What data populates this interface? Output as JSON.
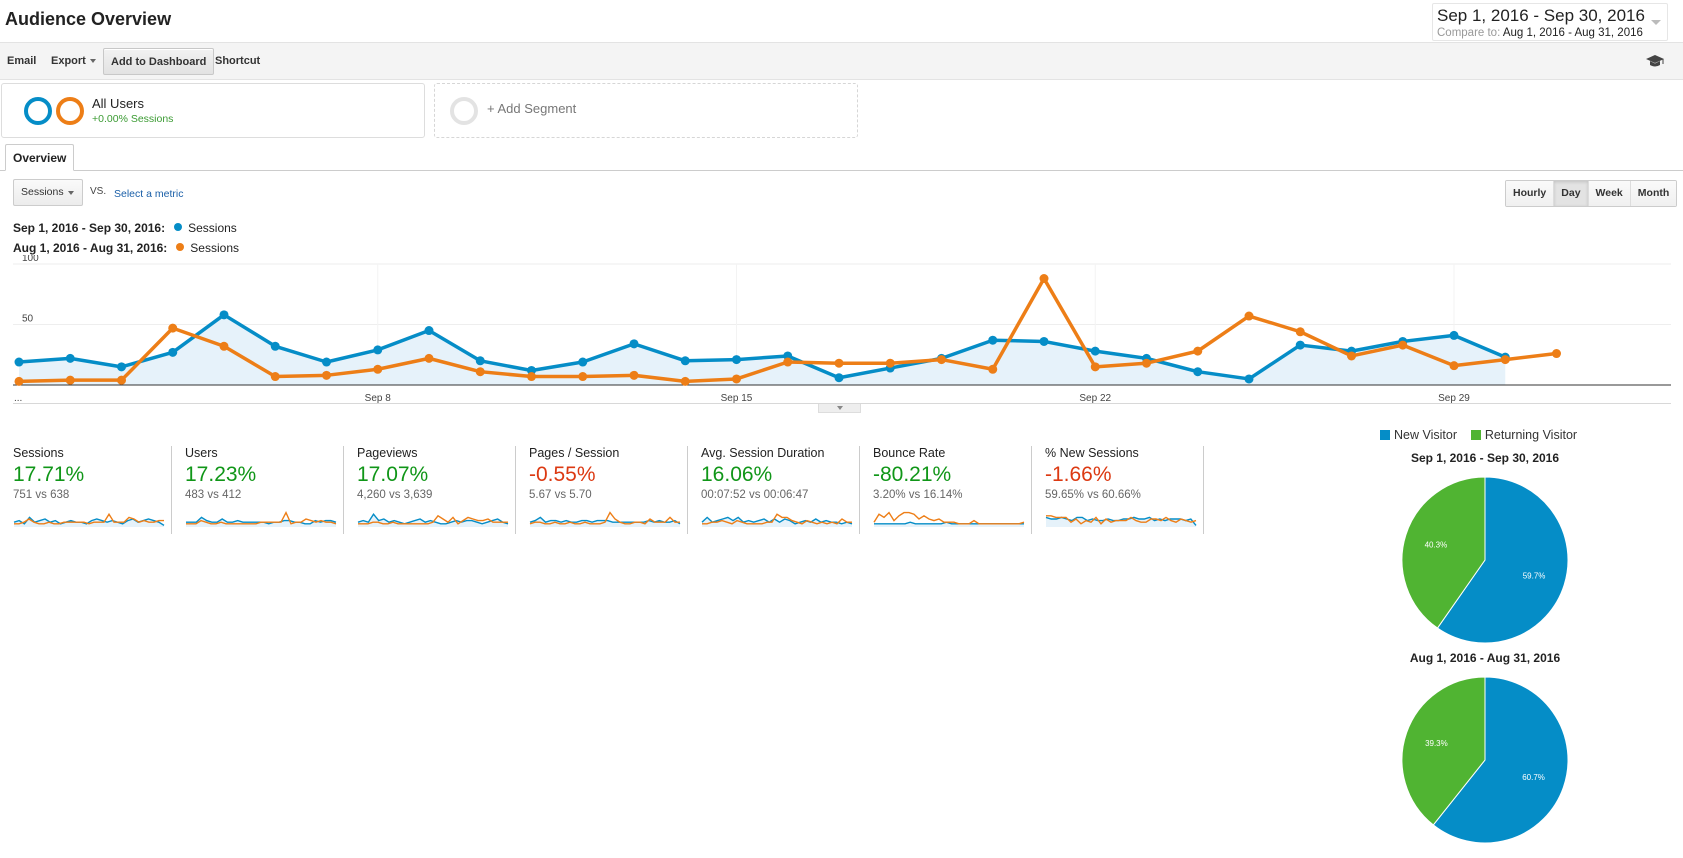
{
  "header": {
    "title": "Audience Overview",
    "date_range": {
      "primary": "Sep 1, 2016 - Sep 30, 2016",
      "compare_label": "Compare to:",
      "compare_range": "Aug 1, 2016 - Aug 31, 2016"
    }
  },
  "toolbar": {
    "email_label": "Email",
    "export_label": "Export",
    "add_dashboard_label": "Add to Dashboard",
    "shortcut_label": "Shortcut",
    "help_icon": "graduation-cap-icon"
  },
  "segments": {
    "active": {
      "name": "All Users",
      "sub": "+0.00% Sessions"
    },
    "add_label": "+ Add Segment"
  },
  "tabs": [
    {
      "label": "Overview",
      "active": true
    }
  ],
  "chart_controls": {
    "metric": "Sessions",
    "vs_label": "VS.",
    "select_metric_label": "Select a metric",
    "intervals": [
      {
        "label": "Hourly",
        "active": false
      },
      {
        "label": "Day",
        "active": true
      },
      {
        "label": "Week",
        "active": false
      },
      {
        "label": "Month",
        "active": false
      }
    ]
  },
  "chart_legend": [
    {
      "range": "Sep 1, 2016 - Sep 30, 2016:",
      "series": "Sessions",
      "color": "#058dc7"
    },
    {
      "range": "Aug 1, 2016 - Aug 31, 2016:",
      "series": "Sessions",
      "color": "#ed7e17"
    }
  ],
  "chart_data": [
    {
      "type": "line",
      "title": "",
      "xlabel": "",
      "ylabel": "Sessions",
      "ylim": [
        0,
        100
      ],
      "yticks": [
        50,
        100
      ],
      "x_tick_labels": [
        "...",
        "Sep 8",
        "Sep 15",
        "Sep 22",
        "Sep 29"
      ],
      "x_tick_index": [
        0,
        7,
        14,
        21,
        28
      ],
      "grid": true,
      "series": [
        {
          "name": "Sep 1, 2016 - Sep 30, 2016: Sessions",
          "color": "#058dc7",
          "area": true,
          "values": [
            19,
            22,
            15,
            27,
            58,
            32,
            19,
            29,
            45,
            20,
            12,
            19,
            34,
            20,
            21,
            24,
            6,
            14,
            22,
            37,
            36,
            28,
            22,
            11,
            5,
            33,
            28,
            36,
            41,
            23
          ]
        },
        {
          "name": "Aug 1, 2016 - Aug 31, 2016: Sessions",
          "color": "#ed7e17",
          "area": false,
          "values": [
            3,
            4,
            4,
            47,
            32,
            7,
            8,
            13,
            22,
            11,
            7,
            7,
            8,
            3,
            5,
            19,
            18,
            18,
            21,
            13,
            88,
            15,
            18,
            28,
            57,
            44,
            24,
            33,
            16,
            21,
            26
          ]
        }
      ]
    },
    {
      "type": "pie",
      "title": "Sep 1, 2016 - Sep 30, 2016",
      "categories": [
        "New Visitor",
        "Returning Visitor"
      ],
      "values": [
        59.7,
        40.3
      ],
      "labels": [
        "59.7%",
        "40.3%"
      ],
      "colors": [
        "#058dc7",
        "#50b432"
      ],
      "legend": "top"
    },
    {
      "type": "pie",
      "title": "Aug 1, 2016 - Aug 31, 2016",
      "categories": [
        "New Visitor",
        "Returning Visitor"
      ],
      "values": [
        60.7,
        39.3
      ],
      "labels": [
        "60.7%",
        "39.3%"
      ],
      "colors": [
        "#058dc7",
        "#50b432"
      ],
      "legend": "top"
    }
  ],
  "metrics": [
    {
      "name": "Sessions",
      "change": "17.71%",
      "trend": "pos",
      "compare": "751 vs 638",
      "spark_a": [
        3,
        4,
        2,
        6,
        3,
        4,
        5,
        3,
        4,
        2,
        3,
        4,
        3,
        3,
        2,
        4,
        5,
        4,
        3,
        4,
        3,
        2,
        4,
        5,
        3,
        4,
        5,
        4,
        3,
        1
      ],
      "spark_b": [
        2,
        2,
        3,
        5,
        3,
        2,
        2,
        3,
        2,
        2,
        3,
        3,
        3,
        3,
        3,
        2,
        3,
        3,
        3,
        8,
        3,
        3,
        3,
        6,
        5,
        3,
        4,
        3,
        3,
        4,
        4
      ]
    },
    {
      "name": "Users",
      "change": "17.23%",
      "trend": "pos",
      "compare": "483 vs 412",
      "spark_a": [
        3,
        3,
        3,
        6,
        4,
        3,
        3,
        5,
        3,
        3,
        4,
        3,
        3,
        3,
        3,
        3,
        2,
        3,
        3,
        4,
        4,
        3,
        3,
        2,
        2,
        4,
        3,
        4,
        4,
        3
      ],
      "spark_b": [
        2,
        2,
        2,
        4,
        3,
        2,
        2,
        3,
        2,
        2,
        2,
        2,
        2,
        2,
        2,
        3,
        3,
        3,
        3,
        3,
        9,
        2,
        3,
        3,
        5,
        4,
        3,
        4,
        3,
        3,
        2
      ]
    },
    {
      "name": "Pageviews",
      "change": "17.07%",
      "trend": "pos",
      "compare": "4,260 vs 3,639",
      "spark_a": [
        3,
        4,
        3,
        8,
        4,
        5,
        3,
        4,
        3,
        2,
        3,
        4,
        5,
        3,
        4,
        3,
        2,
        2,
        3,
        4,
        3,
        4,
        4,
        3,
        2,
        3,
        4,
        5,
        3,
        2
      ],
      "spark_b": [
        2,
        2,
        2,
        3,
        3,
        2,
        2,
        3,
        2,
        2,
        2,
        2,
        2,
        2,
        2,
        3,
        7,
        5,
        3,
        6,
        2,
        4,
        6,
        5,
        4,
        4,
        5,
        3,
        3,
        3,
        3
      ]
    },
    {
      "name": "Pages / Session",
      "change": "-0.55%",
      "trend": "neg",
      "compare": "5.67 vs 5.70",
      "spark_a": [
        3,
        4,
        6,
        3,
        4,
        4,
        3,
        4,
        3,
        3,
        4,
        4,
        3,
        4,
        4,
        4,
        3,
        3,
        3,
        3,
        3,
        3,
        3,
        4,
        3,
        4,
        3,
        3,
        4,
        2
      ],
      "spark_b": [
        2,
        3,
        3,
        2,
        2,
        3,
        2,
        2,
        3,
        2,
        2,
        3,
        2,
        2,
        2,
        3,
        9,
        5,
        3,
        2,
        2,
        3,
        3,
        2,
        5,
        3,
        3,
        3,
        6,
        3,
        3
      ]
    },
    {
      "name": "Avg. Session Duration",
      "change": "16.06%",
      "trend": "pos",
      "compare": "00:07:52 vs 00:06:47",
      "spark_a": [
        3,
        6,
        3,
        4,
        5,
        6,
        4,
        6,
        3,
        4,
        3,
        4,
        5,
        3,
        5,
        3,
        5,
        4,
        2,
        3,
        4,
        3,
        5,
        3,
        4,
        3,
        3,
        2,
        3,
        2
      ],
      "spark_b": [
        2,
        2,
        3,
        3,
        4,
        3,
        2,
        4,
        3,
        2,
        2,
        2,
        2,
        3,
        3,
        8,
        6,
        6,
        4,
        3,
        2,
        4,
        3,
        2,
        3,
        2,
        3,
        2,
        5,
        3,
        3
      ]
    },
    {
      "name": "Bounce Rate",
      "change": "-80.21%",
      "trend": "pos",
      "compare": "3.20% vs 16.14%",
      "spark_a": [
        2,
        2,
        2,
        2,
        2,
        2,
        2,
        3,
        2,
        2,
        2,
        2,
        2,
        2,
        3,
        2,
        2,
        2,
        2,
        2,
        2,
        2,
        2,
        2,
        2,
        2,
        2,
        2,
        2,
        2
      ],
      "spark_b": [
        3,
        8,
        6,
        9,
        4,
        7,
        9,
        9,
        8,
        5,
        7,
        5,
        4,
        5,
        3,
        3,
        3,
        2,
        2,
        2,
        4,
        2,
        2,
        2,
        2,
        2,
        2,
        2,
        2,
        2,
        3
      ]
    },
    {
      "name": "% New Sessions",
      "change": "-1.66%",
      "trend": "neg",
      "compare": "59.65% vs 60.66%",
      "spark_a": [
        6,
        5,
        5,
        6,
        5,
        4,
        6,
        6,
        4,
        5,
        4,
        4,
        5,
        4,
        4,
        5,
        5,
        6,
        5,
        5,
        6,
        4,
        5,
        4,
        5,
        5,
        5,
        4,
        5,
        1
      ],
      "spark_b": [
        7,
        7,
        6,
        6,
        6,
        3,
        5,
        2,
        4,
        3,
        6,
        2,
        5,
        3,
        4,
        4,
        4,
        6,
        4,
        3,
        3,
        5,
        5,
        4,
        6,
        4,
        3,
        5,
        4,
        3,
        4
      ]
    }
  ],
  "pie_legend": [
    {
      "label": "New Visitor",
      "color": "#058dc7"
    },
    {
      "label": "Returning Visitor",
      "color": "#50b432"
    }
  ]
}
